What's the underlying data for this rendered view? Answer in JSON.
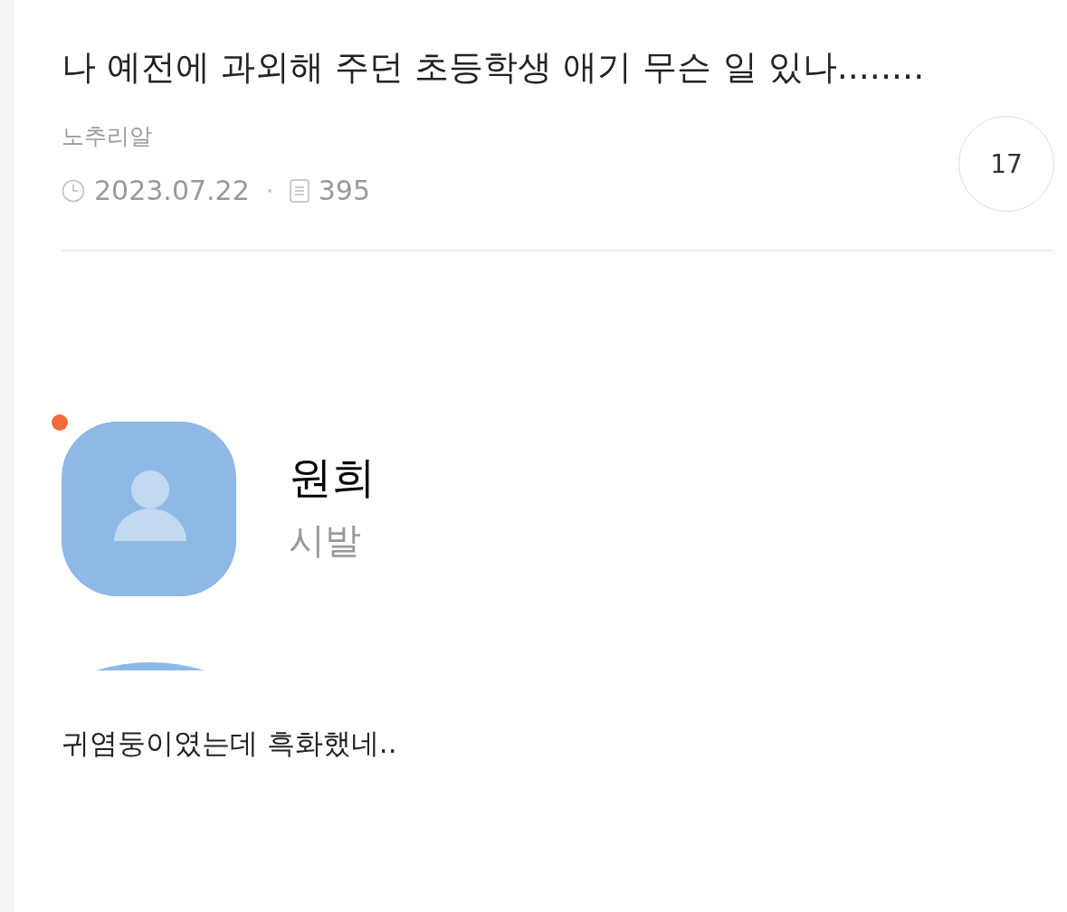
{
  "post": {
    "title": "나 예전에 과외해 주던 초등학생 애기 무슨 일 있나........",
    "author": "노추리알",
    "date": "2023.07.22",
    "views": "395",
    "comment_count": "17"
  },
  "contact": {
    "name": "원희",
    "status": "시발",
    "new_badge": true
  },
  "body": "귀염둥이였는데 흑화했네.."
}
